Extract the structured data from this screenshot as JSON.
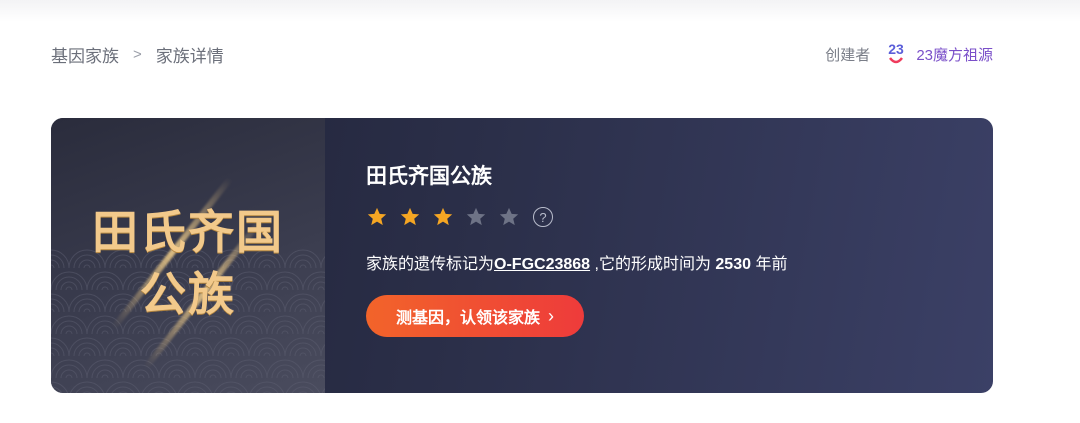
{
  "breadcrumb": {
    "items": [
      "基因家族",
      "家族详情"
    ],
    "separator": ">"
  },
  "creator": {
    "label": "创建者",
    "name": "23魔方祖源",
    "logo_text": "23"
  },
  "family": {
    "badge_line1": "田氏齐国",
    "badge_line2": "公族",
    "title": "田氏齐国公族",
    "rating": 3,
    "rating_max": 5,
    "help_symbol": "?",
    "desc_prefix": "家族的遗传标记为",
    "marker_code": "O-FGC23868",
    "desc_middle": " ,它的形成时间为 ",
    "years": "2530",
    "desc_suffix": " 年前",
    "cta_label": "测基因，认领该家族",
    "cta_icon": "chevron-right-icon"
  },
  "colors": {
    "star_filled": "#f5a623",
    "star_empty": "#6e7386",
    "accent": "#7a4fc9",
    "cta_start": "#f2642a",
    "cta_end": "#ee3b3b"
  }
}
